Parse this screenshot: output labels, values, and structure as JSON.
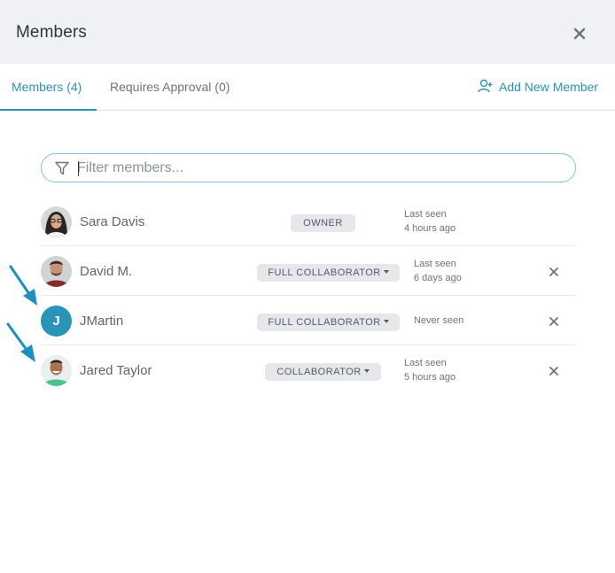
{
  "header": {
    "title": "Members",
    "close_icon": "close-icon"
  },
  "tabs": [
    {
      "label": "Members (4)",
      "active": true
    },
    {
      "label": "Requires Approval (0)",
      "active": false
    }
  ],
  "actions": {
    "add_member_label": "Add New Member",
    "add_member_icon": "add-user-icon"
  },
  "filter": {
    "placeholder": "Filter members...",
    "value": ""
  },
  "members": [
    {
      "name": "Sara Davis",
      "role": "OWNER",
      "role_dropdown": false,
      "seen_line1": "Last seen",
      "seen_line2": "4 hours ago",
      "removable": false
    },
    {
      "name": "David M.",
      "role": "FULL COLLABORATOR",
      "role_dropdown": true,
      "seen_line1": "Last seen",
      "seen_line2": "6 days ago",
      "removable": true
    },
    {
      "name": "JMartin",
      "initial": "J",
      "role": "FULL COLLABORATOR",
      "role_dropdown": true,
      "seen_line1": "Never seen",
      "seen_line2": "",
      "removable": true
    },
    {
      "name": "Jared Taylor",
      "role": "COLLABORATOR",
      "role_dropdown": true,
      "seen_line1": "Last seen",
      "seen_line2": "5 hours ago",
      "removable": true
    }
  ],
  "colors": {
    "accent": "#2a93b8",
    "header_bg": "#eff1f4",
    "badge_bg": "#e5e7ea",
    "avatar_j": "#2a93b8"
  }
}
